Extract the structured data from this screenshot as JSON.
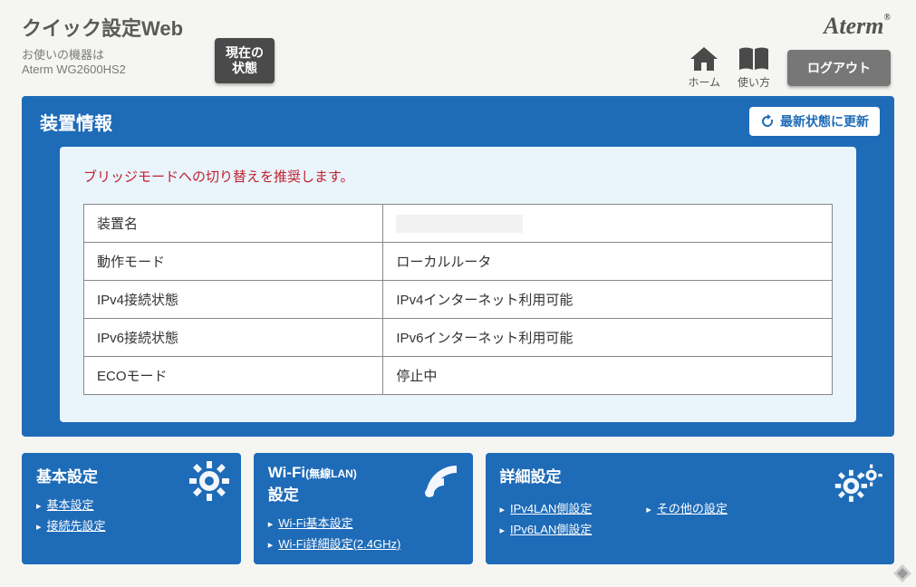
{
  "header": {
    "title": "クイック設定Web",
    "device_label": "お使いの機器は",
    "device_name": "Aterm WG2600HS2",
    "current_status_btn": "現在の\n状態",
    "brand": "Aterm",
    "nav_home": "ホーム",
    "nav_howto": "使い方",
    "logout": "ログアウト"
  },
  "panel": {
    "title": "装置情報",
    "refresh": "最新状態に更新",
    "notice": "ブリッジモードへの切り替えを推奨します。",
    "rows": [
      {
        "label": "装置名",
        "value": ""
      },
      {
        "label": "動作モード",
        "value": "ローカルルータ"
      },
      {
        "label": "IPv4接続状態",
        "value": "IPv4インターネット利用可能"
      },
      {
        "label": "IPv6接続状態",
        "value": "IPv6インターネット利用可能"
      },
      {
        "label": "ECOモード",
        "value": "停止中"
      }
    ]
  },
  "cards": {
    "basic": {
      "title": "基本設定",
      "links": [
        "基本設定",
        "接続先設定"
      ]
    },
    "wifi": {
      "title_main": "Wi-Fi",
      "title_sub": "(無線LAN)",
      "title_line2": "設定",
      "links": [
        "Wi-Fi基本設定",
        "Wi-Fi詳細設定(2.4GHz)"
      ]
    },
    "advanced": {
      "title": "詳細設定",
      "links_col1": [
        "IPv4LAN側設定",
        "IPv6LAN側設定"
      ],
      "links_col2": [
        "その他の設定"
      ]
    }
  }
}
